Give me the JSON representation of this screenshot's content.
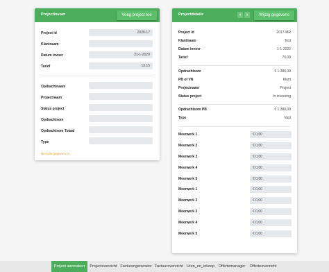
{
  "left_card": {
    "title": "Projectinvoer",
    "add_button": "Voeg project toe",
    "fields": [
      {
        "label": "Project id",
        "value": "2020-17"
      },
      {
        "label": "Klantnaam",
        "value": ""
      },
      {
        "label": "Datum invoer",
        "value": "21-1-2020"
      },
      {
        "label": "Tarief",
        "value": "13.15"
      }
    ],
    "fields2": [
      {
        "label": "Opdrachtnaam",
        "value": ""
      },
      {
        "label": "Projectnaam",
        "value": ""
      },
      {
        "label": "Status project",
        "value": ""
      },
      {
        "label": "Opdrachtsom",
        "value": ""
      },
      {
        "label": "Opdrachtsom Totaal",
        "value": ""
      },
      {
        "label": "Type",
        "value": ""
      }
    ],
    "warning": "Niet alle gegevens in"
  },
  "right_card": {
    "title": "Projectdetails",
    "prev_icon": "chevron-left-icon",
    "next_icon": "chevron-right-icon",
    "edit_button": "Wijzig gegevens",
    "details": [
      {
        "label": "Project id",
        "value": "2017-MR"
      },
      {
        "label": "Klantnaam",
        "value": "Test"
      },
      {
        "label": "Datum invoer",
        "value": "1-1-2022"
      },
      {
        "label": "Tarief",
        "value": "70,00"
      }
    ],
    "details2": [
      {
        "label": "Opdrachtsom",
        "value": "€ 1.380,00"
      },
      {
        "label": "PB of VN",
        "value": "Klant"
      },
      {
        "label": "Projectnaam",
        "value": "Project"
      },
      {
        "label": "Status project",
        "value": "In invoering"
      }
    ],
    "details3": [
      {
        "label": "Opdrachtsom PB",
        "value": "€ 1.380,00"
      },
      {
        "label": "Type",
        "value": "Vast"
      }
    ],
    "meerwerk": [
      {
        "label": "Meerwerk 1",
        "value": "€ 0,00"
      },
      {
        "label": "Meerwerk 2",
        "value": "€ 0,00"
      },
      {
        "label": "Meerwerk 3",
        "value": "€ 0,00"
      },
      {
        "label": "Meerwerk 4",
        "value": "€ 0,00"
      },
      {
        "label": "Meerwerk 5",
        "value": "€ 0,00"
      },
      {
        "label": "Meerwerk 1",
        "value": "€ 0,00"
      },
      {
        "label": "Meerwerk 2",
        "value": "€ 0,00"
      },
      {
        "label": "Meerwerk 3",
        "value": "€ 0,00"
      },
      {
        "label": "Meerwerk 4",
        "value": "€ 0,00"
      },
      {
        "label": "Meerwerk 5",
        "value": "€ 0,00"
      }
    ]
  },
  "tabs": [
    {
      "label": "Project aanmaken",
      "active": true
    },
    {
      "label": "Projectoverzicht",
      "active": false
    },
    {
      "label": "Facturengenerator",
      "active": false
    },
    {
      "label": "Factuuroverzicht",
      "active": false
    },
    {
      "label": "Uren_en_inkoop",
      "active": false
    },
    {
      "label": "Offertemanager",
      "active": false
    },
    {
      "label": "Offerteoverzicht",
      "active": false
    }
  ],
  "colors": {
    "accent": "#4cae5c",
    "warning": "#f0a020",
    "field_bg": "#e5e8ec"
  }
}
